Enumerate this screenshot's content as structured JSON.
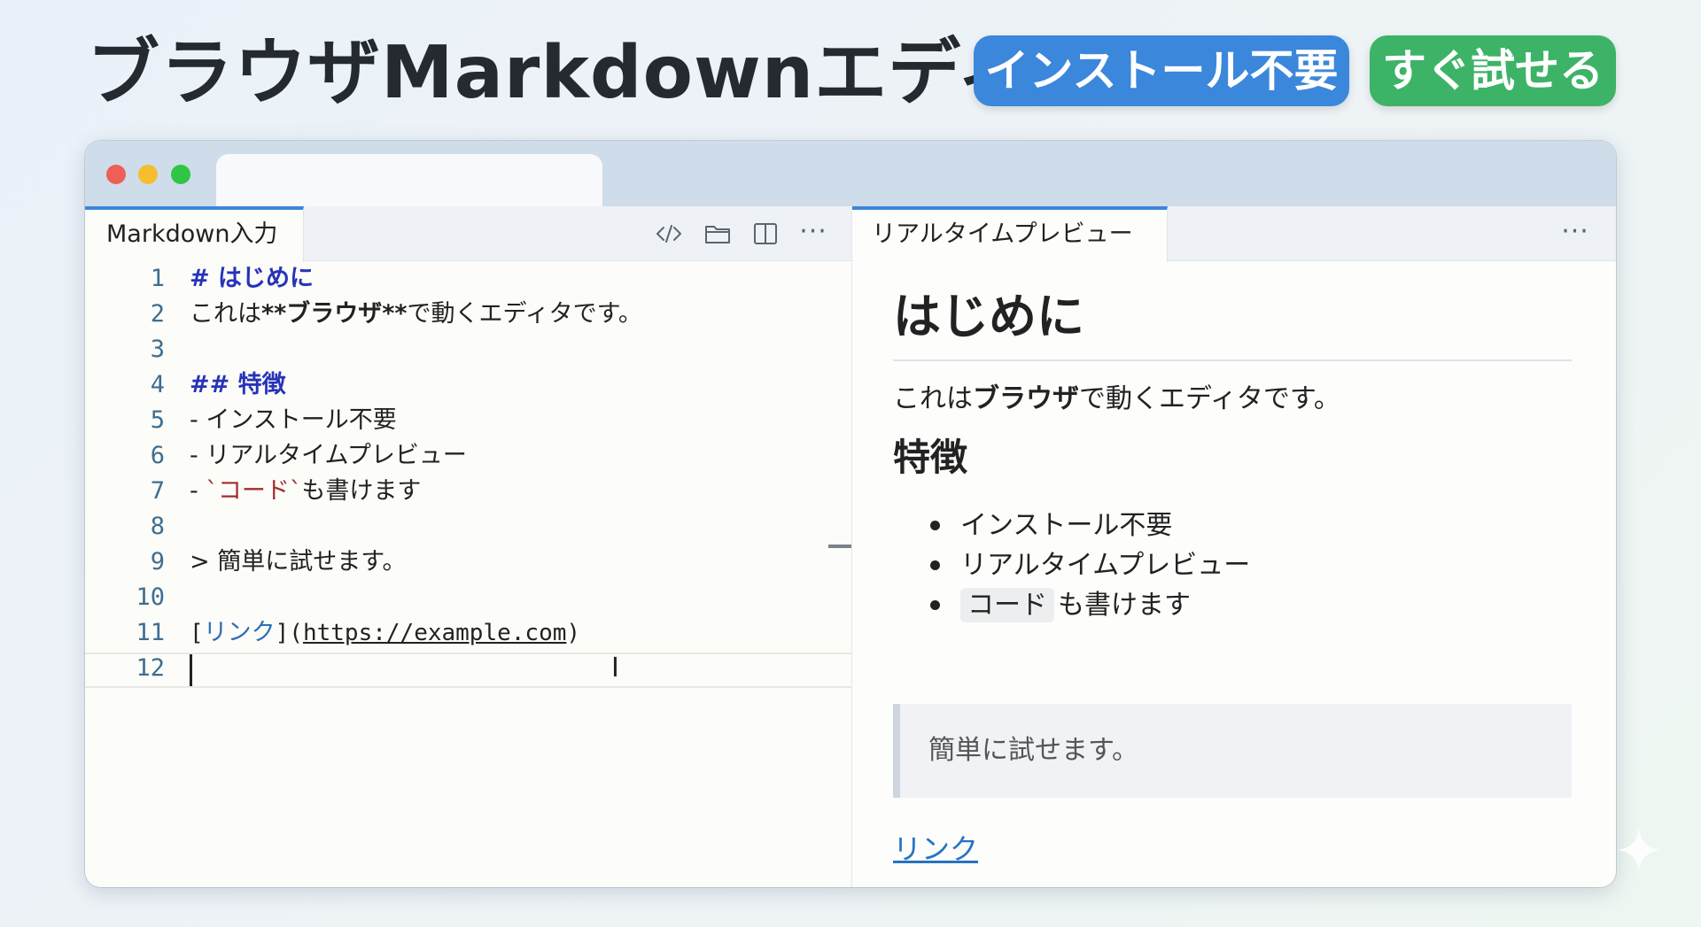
{
  "header": {
    "title": "ブラウザMarkdownエディタ",
    "badges": [
      "インストール不要",
      "すぐ試せる"
    ]
  },
  "colors": {
    "badge_blue": "#3b87db",
    "badge_green": "#3db367",
    "heading_syntax": "#2733b8",
    "inline_code": "#a32d2d",
    "link": "#2573c3",
    "line_number": "#3e6e91",
    "tab_accent": "#3c86dc"
  },
  "editor": {
    "tab_label": "Markdown入力",
    "toolbar_icons": [
      "code-icon",
      "folder-icon",
      "split-view-icon",
      "more-icon"
    ],
    "lines": [
      {
        "num": "1",
        "text": "# はじめに"
      },
      {
        "num": "2",
        "text": "これは**ブラウザ**で動くエディタです。"
      },
      {
        "num": "3",
        "text": ""
      },
      {
        "num": "4",
        "text": "## 特徴"
      },
      {
        "num": "5",
        "text": "- インストール不要"
      },
      {
        "num": "6",
        "text": "- リアルタイムプレビュー"
      },
      {
        "num": "7",
        "text": "- `コード`も書けます"
      },
      {
        "num": "8",
        "text": ""
      },
      {
        "num": "9",
        "text": "> 簡単に試せます。"
      },
      {
        "num": "10",
        "text": ""
      },
      {
        "num": "11",
        "text": "[リンク](https://example.com)"
      },
      {
        "num": "12",
        "text": ""
      }
    ],
    "tokens": {
      "l1_mark": "# ",
      "l1_text": "はじめに",
      "l2_before": "これは",
      "l2_bold": "**ブラウザ**",
      "l2_after": "で動くエディタです。",
      "l4_mark": "## ",
      "l4_text": "特徴",
      "l5": "- インストール不要",
      "l6": "- リアルタイムプレビュー",
      "l7_dash": "- ",
      "l7_code": "`コード`",
      "l7_after": "も書けます",
      "l9": "> 簡単に試せます。",
      "l11_open": "[",
      "l11_link": "リンク",
      "l11_mid": "](",
      "l11_url": "https://example.com",
      "l11_close": ")"
    }
  },
  "preview": {
    "tab_label": "リアルタイムプレビュー",
    "h1": "はじめに",
    "paragraph_before": "これは",
    "paragraph_bold": "ブラウザ",
    "paragraph_after": "で動くエディタです。",
    "h2": "特徴",
    "list": [
      "インストール不要",
      "リアルタイムプレビュー"
    ],
    "list_code": "コード",
    "list_code_after": "も書けます",
    "blockquote": "簡単に試せます。",
    "link_text": "リンク"
  }
}
